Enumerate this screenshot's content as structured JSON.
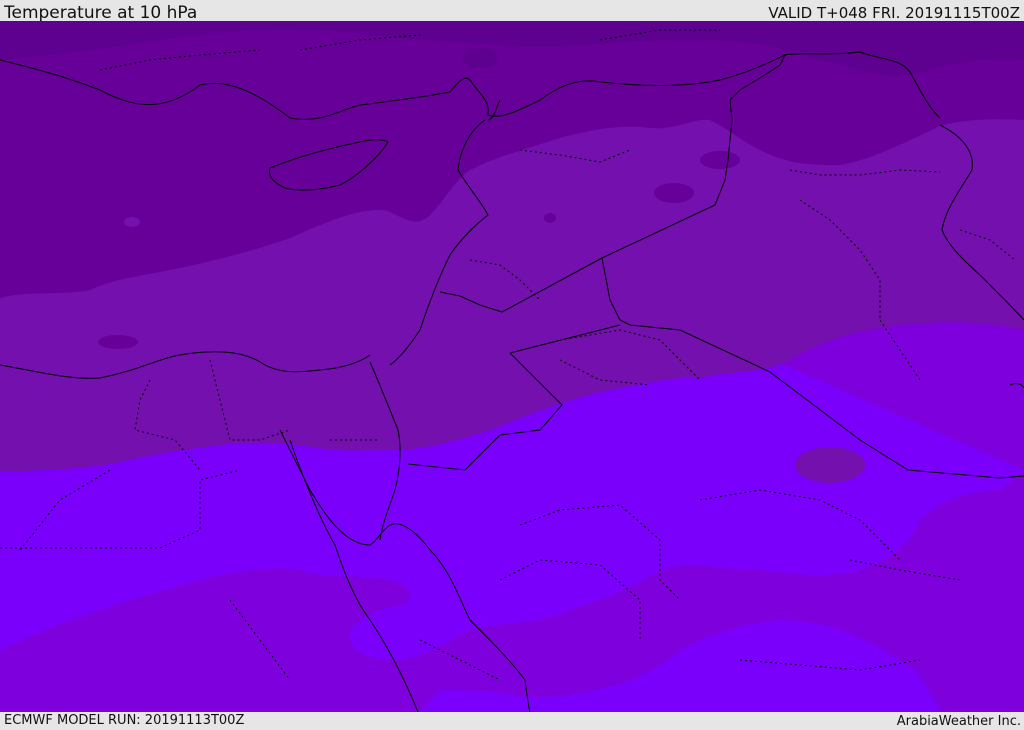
{
  "header": {
    "title": "Temperature at 10 hPa",
    "valid": "VALID T+048 FRI. 20191115T00Z"
  },
  "footer": {
    "model_run": "ECMWF MODEL RUN: 20191113T00Z",
    "credit": "ArabiaWeather Inc."
  },
  "colors": {
    "band_darkest": "#5e0090",
    "band_dark": "#660098",
    "band_mid": "#7310ae",
    "band_bright": "#7e00dc",
    "band_brightest": "#7a00fc",
    "coast": "#000000"
  }
}
